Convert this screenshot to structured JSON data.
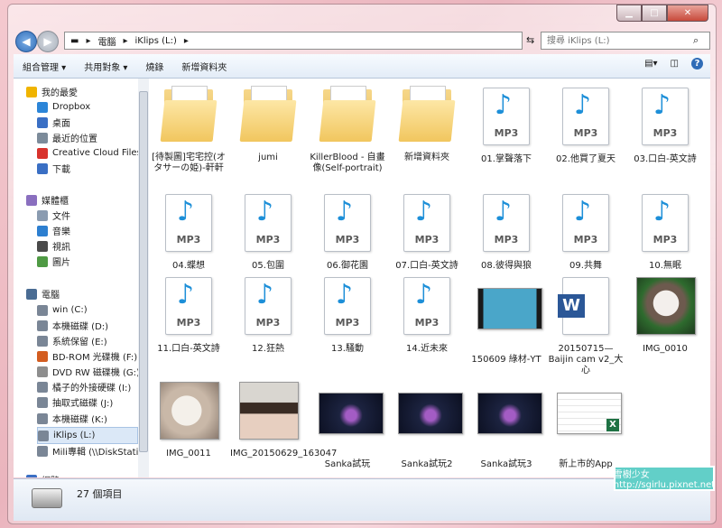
{
  "window": {
    "title_buttons": [
      "minimize",
      "maximize",
      "close"
    ]
  },
  "address": {
    "crumbs": [
      "電腦",
      "iKlips (L:)"
    ],
    "search_placeholder": "搜尋 iKlips (L:)"
  },
  "toolbar": {
    "items": [
      "組合管理 ▾",
      "共用對象 ▾",
      "燒錄",
      "新增資料夾"
    ]
  },
  "sidebar": {
    "items": [
      {
        "label": "我的最愛",
        "icon": "star-icon",
        "color": "#f0b400"
      },
      {
        "label": "Dropbox",
        "icon": "dropbox-icon",
        "color": "#2c85d8"
      },
      {
        "label": "桌面",
        "icon": "desktop-icon",
        "color": "#3a6fc4"
      },
      {
        "label": "最近的位置",
        "icon": "recent-places-icon",
        "color": "#7c8b9a"
      },
      {
        "label": "Creative Cloud Files",
        "icon": "creative-cloud-icon",
        "color": "#d8322c"
      },
      {
        "label": "下載",
        "icon": "downloads-icon",
        "color": "#3a6fc4"
      },
      {
        "label": "媒體櫃",
        "icon": "libraries-icon",
        "color": "#8a6fbf"
      },
      {
        "label": "文件",
        "icon": "documents-icon",
        "color": "#8a9bb0"
      },
      {
        "label": "音樂",
        "icon": "music-icon",
        "color": "#2d7fd0"
      },
      {
        "label": "視訊",
        "icon": "video-icon",
        "color": "#4a4a4a"
      },
      {
        "label": "圖片",
        "icon": "pictures-icon",
        "color": "#4f9a44"
      },
      {
        "label": "電腦",
        "icon": "computer-icon",
        "color": "#4a6c93"
      },
      {
        "label": "win (C:)",
        "icon": "drive-icon",
        "color": "#7a8696"
      },
      {
        "label": "本機磁碟 (D:)",
        "icon": "drive-icon",
        "color": "#7a8696"
      },
      {
        "label": "系統保留 (E:)",
        "icon": "drive-icon",
        "color": "#7a8696"
      },
      {
        "label": "BD-ROM 光碟機 (F:)",
        "icon": "bd-rom-icon",
        "color": "#d35d20"
      },
      {
        "label": "DVD RW 磁碟機 (G:)",
        "icon": "dvd-icon",
        "color": "#8e8e8e"
      },
      {
        "label": "橘子的外接硬碟 (I:)",
        "icon": "drive-icon",
        "color": "#7a8696"
      },
      {
        "label": "抽取式磁碟 (J:)",
        "icon": "removable-drive-icon",
        "color": "#7a8696"
      },
      {
        "label": "本機磁碟 (K:)",
        "icon": "drive-icon",
        "color": "#7a8696"
      },
      {
        "label": "iKlips (L:)",
        "icon": "removable-drive-icon",
        "color": "#7a8696"
      },
      {
        "label": "Mili專輯 (\\\\DiskStatio",
        "icon": "network-drive-icon",
        "color": "#7a8696"
      },
      {
        "label": "網路",
        "icon": "network-icon",
        "color": "#3a6fc4"
      }
    ]
  },
  "files": [
    {
      "name": "[待製圖]宅宅控(オタサーの姫)-軒軒",
      "kind": "folder"
    },
    {
      "name": "jumi",
      "kind": "folder"
    },
    {
      "name": "KillerBlood - 自畫像(Self-portrait)",
      "kind": "folder"
    },
    {
      "name": "新增資料夾",
      "kind": "folder"
    },
    {
      "name": "01.掌聲落下",
      "kind": "mp3"
    },
    {
      "name": "02.他買了夏天",
      "kind": "mp3"
    },
    {
      "name": "03.口白-英文詩",
      "kind": "mp3"
    },
    {
      "name": "04.蝶想",
      "kind": "mp3"
    },
    {
      "name": "05.包圍",
      "kind": "mp3"
    },
    {
      "name": "06.御花園",
      "kind": "mp3"
    },
    {
      "name": "07.口白-英文詩",
      "kind": "mp3"
    },
    {
      "name": "08.彼得與狼",
      "kind": "mp3"
    },
    {
      "name": "09.共舞",
      "kind": "mp3"
    },
    {
      "name": "10.無眠",
      "kind": "mp3"
    },
    {
      "name": "11.口白-英文詩",
      "kind": "mp3"
    },
    {
      "name": "12.狂熱",
      "kind": "mp3"
    },
    {
      "name": "13.騷動",
      "kind": "mp3"
    },
    {
      "name": "14.近未來",
      "kind": "mp3"
    },
    {
      "name": "150609 綠材-YT",
      "kind": "video"
    },
    {
      "name": "20150715—Baijin cam v2_大心",
      "kind": "word"
    },
    {
      "name": "IMG_0010",
      "kind": "photo"
    },
    {
      "name": "IMG_0011",
      "kind": "photo"
    },
    {
      "name": "IMG_20150629_163047",
      "kind": "photo"
    },
    {
      "name": "Sanka試玩",
      "kind": "game"
    },
    {
      "name": "Sanka試玩2",
      "kind": "game"
    },
    {
      "name": "Sanka試玩3",
      "kind": "game"
    },
    {
      "name": "新上市的App",
      "kind": "excel"
    }
  ],
  "mp3_label": "MP3",
  "status": {
    "count": "27 個項目"
  },
  "watermark": {
    "text": "雪樹少女  http://sgirlu.pixnet.net"
  }
}
